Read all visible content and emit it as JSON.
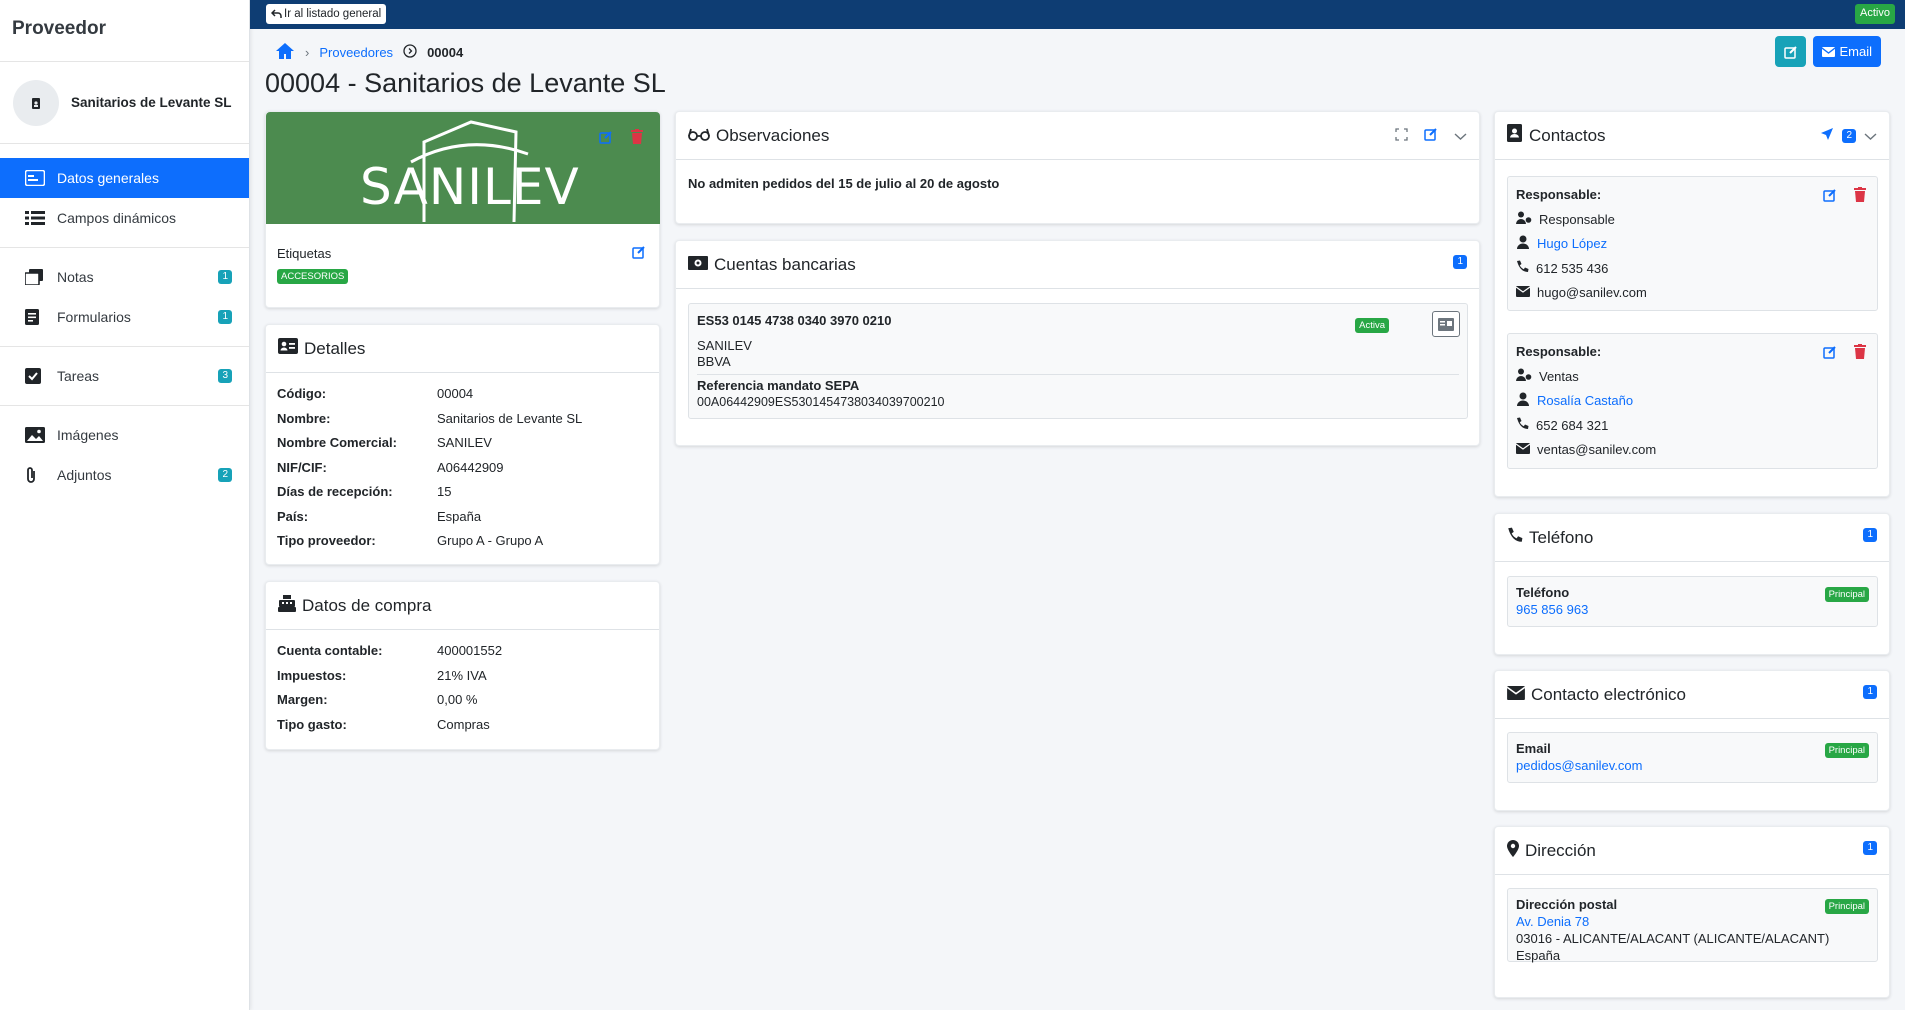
{
  "sidebar": {
    "title": "Proveedor",
    "user_name": "Sanitarios de Levante SL",
    "items": [
      {
        "label": "Datos generales"
      },
      {
        "label": "Campos dinámicos"
      },
      {
        "label": "Notas",
        "count": "1"
      },
      {
        "label": "Formularios",
        "count": "1"
      },
      {
        "label": "Tareas",
        "count": "3"
      },
      {
        "label": "Imágenes"
      },
      {
        "label": "Adjuntos",
        "count": "2"
      }
    ]
  },
  "topbar": {
    "back_label": "Ir al listado general",
    "status": "Activo"
  },
  "breadcrumb": {
    "section": "Proveedores",
    "current": "00004"
  },
  "page_title": "00004 - Sanitarios de Levante SL",
  "header_buttons": {
    "email_label": "Email"
  },
  "logo": {
    "brand": "SANILEV"
  },
  "tags": {
    "title": "Etiquetas",
    "items": [
      "ACCESORIOS"
    ]
  },
  "detalles": {
    "title": "Detalles",
    "rows": [
      {
        "k": "Código:",
        "v": "00004"
      },
      {
        "k": "Nombre:",
        "v": "Sanitarios de Levante SL"
      },
      {
        "k": "Nombre Comercial:",
        "v": "SANILEV"
      },
      {
        "k": "NIF/CIF:",
        "v": "A06442909"
      },
      {
        "k": "Días de recepción:",
        "v": "15"
      },
      {
        "k": "País:",
        "v": "España"
      },
      {
        "k": "Tipo proveedor:",
        "v": "Grupo A - Grupo A"
      }
    ]
  },
  "compra": {
    "title": "Datos de compra",
    "rows": [
      {
        "k": "Cuenta contable:",
        "v": "400001552"
      },
      {
        "k": "Impuestos:",
        "v": "21% IVA"
      },
      {
        "k": "Margen:",
        "v": "0,00 %"
      },
      {
        "k": "Tipo gasto:",
        "v": "Compras"
      }
    ]
  },
  "observaciones": {
    "title": "Observaciones",
    "text": "No admiten pedidos del 15 de julio al 20 de agosto"
  },
  "cuentas": {
    "title": "Cuentas bancarias",
    "count": "1",
    "iban": "ES53 0145 4738 0340 3970 0210",
    "status": "Activa",
    "holder": "SANILEV",
    "bank": "BBVA",
    "sepa_label": "Referencia mandato SEPA",
    "sepa_ref": "00A06442909ES5301454738034039700210"
  },
  "contactos": {
    "title": "Contactos",
    "count": "2",
    "items": [
      {
        "heading": "Responsable:",
        "role": "Responsable",
        "name": "Hugo López",
        "phone": "612 535 436",
        "email": "hugo@sanilev.com"
      },
      {
        "heading": "Responsable:",
        "role": "Ventas",
        "name": "Rosalía Castaño",
        "phone": "652 684 321",
        "email": "ventas@sanilev.com"
      }
    ]
  },
  "telefono": {
    "title": "Teléfono",
    "count": "1",
    "label": "Teléfono",
    "value": "965 856 963",
    "badge": "Principal"
  },
  "electronico": {
    "title": "Contacto electrónico",
    "count": "1",
    "label": "Email",
    "value": "pedidos@sanilev.com",
    "badge": "Principal"
  },
  "direccion": {
    "title": "Dirección",
    "count": "1",
    "label": "Dirección postal",
    "street": "Av. Denia 78",
    "city": "03016 - ALICANTE/ALACANT (ALICANTE/ALACANT)",
    "country": "España",
    "badge": "Principal"
  },
  "colors": {
    "primary": "#0d6efd",
    "topbar": "#0e3d73",
    "success": "#28a745",
    "info": "#17a2b8",
    "danger": "#dc3545",
    "logo_bg": "#4c8b4f"
  }
}
